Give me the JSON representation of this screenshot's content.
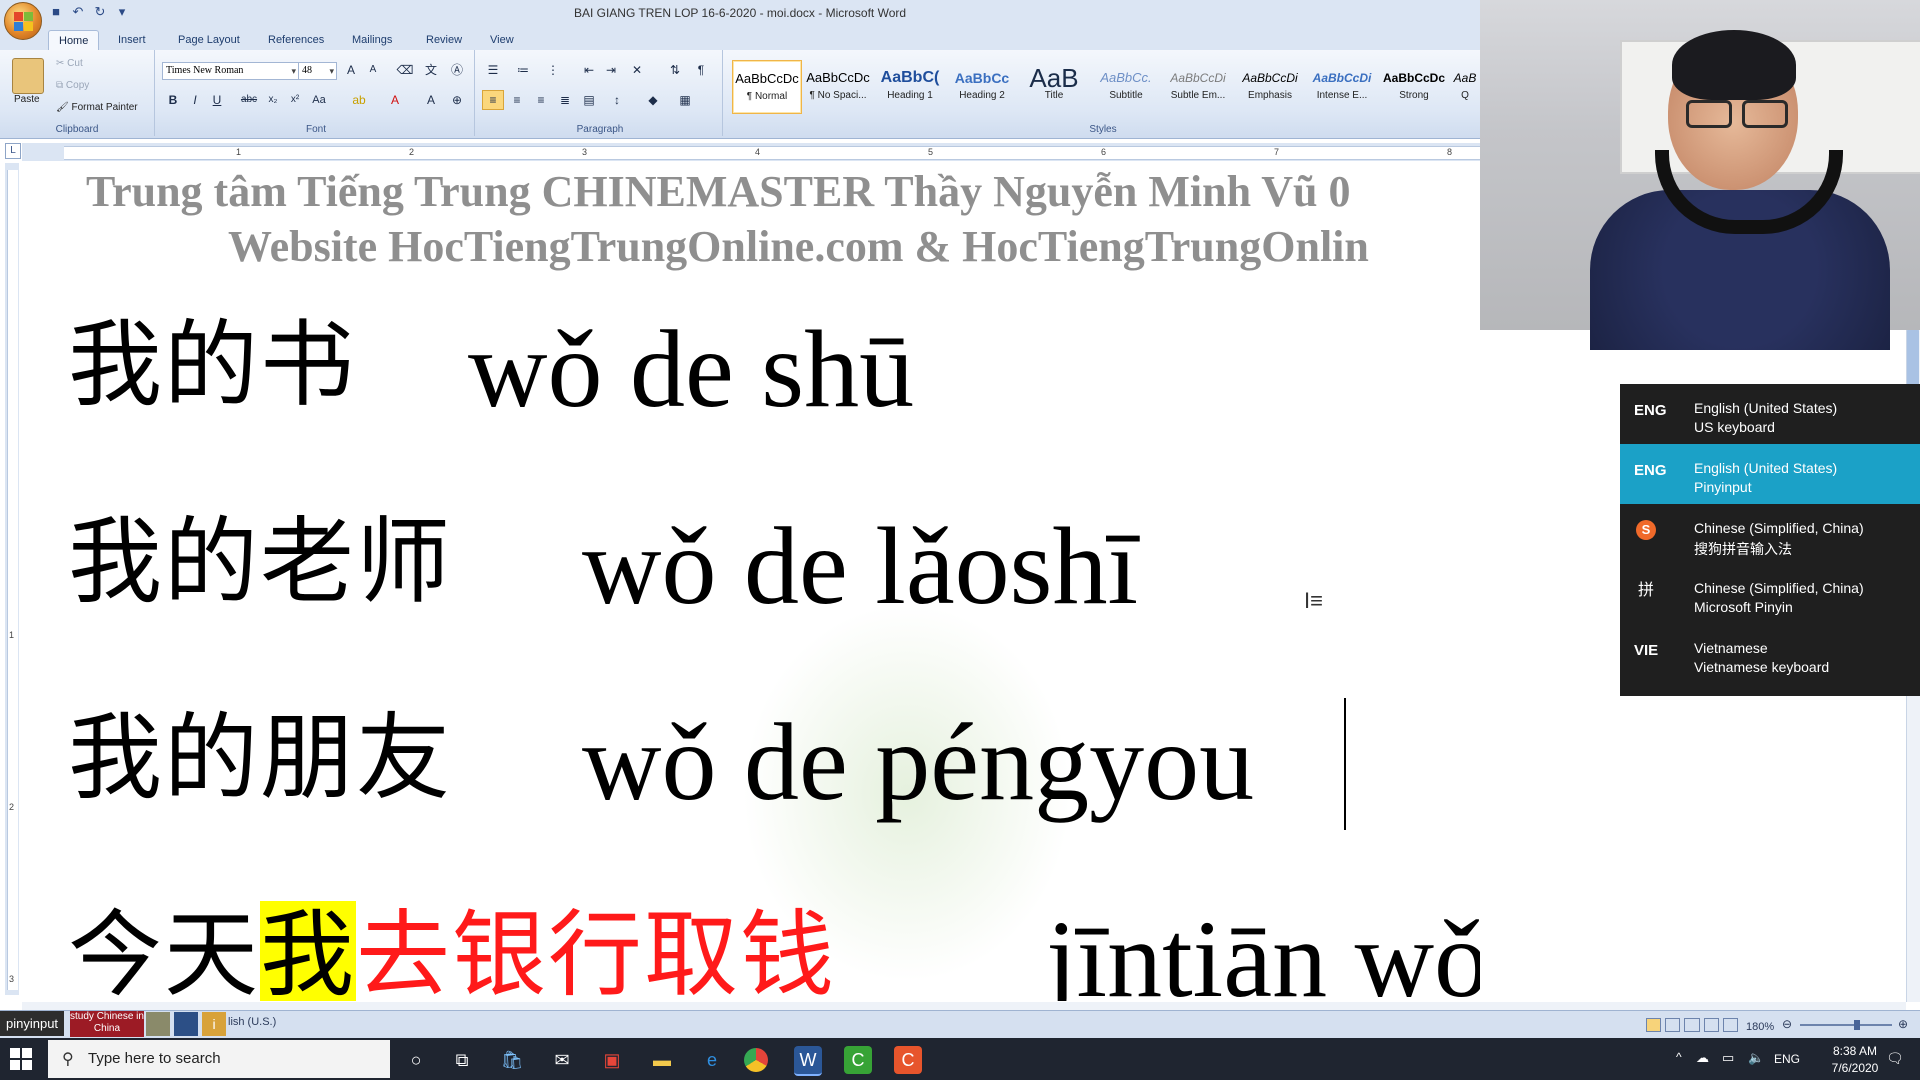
{
  "window": {
    "title": "BAI GIANG TREN LOP 16-6-2020 - moi.docx - Microsoft Word"
  },
  "tabs": [
    "Home",
    "Insert",
    "Page Layout",
    "References",
    "Mailings",
    "Review",
    "View"
  ],
  "ribbon": {
    "clipboard": {
      "paste": "Paste",
      "cut": "Cut",
      "copy": "Copy",
      "format_painter": "Format Painter",
      "label": "Clipboard"
    },
    "font": {
      "name": "Times New Roman",
      "size": "48",
      "label": "Font"
    },
    "paragraph": {
      "label": "Paragraph"
    },
    "styles": {
      "label": "Styles",
      "items": [
        {
          "preview": "AaBbCcDc",
          "name": "¶ Normal"
        },
        {
          "preview": "AaBbCcDc",
          "name": "¶ No Spaci..."
        },
        {
          "preview": "AaBbC(",
          "name": "Heading 1"
        },
        {
          "preview": "AaBbCc",
          "name": "Heading 2"
        },
        {
          "preview": "AaB",
          "name": "Title"
        },
        {
          "preview": "AaBbCc.",
          "name": "Subtitle"
        },
        {
          "preview": "AaBbCcDi",
          "name": "Subtle Em..."
        },
        {
          "preview": "AaBbCcDi",
          "name": "Emphasis"
        },
        {
          "preview": "AaBbCcDi",
          "name": "Intense E..."
        },
        {
          "preview": "AaBbCcDc",
          "name": "Strong"
        },
        {
          "preview": "AaB",
          "name": "Q"
        }
      ]
    }
  },
  "ruler": {
    "h_numbers": [
      "1",
      "2",
      "3",
      "4",
      "5",
      "6",
      "7",
      "8"
    ],
    "v_numbers": [
      "1",
      "2",
      "3"
    ]
  },
  "document": {
    "header_line1": "Trung tâm Tiếng Trung CHINEMASTER Thầy Nguyễn Minh Vũ 0",
    "header_line2": "Website HocTiengTrungOnline.com & HocTiengTrungOnlin",
    "lines": [
      {
        "hanzi": "我的书",
        "pinyin": "wǒ de shū"
      },
      {
        "hanzi": "我的老师",
        "pinyin": "wǒ de lǎoshī"
      },
      {
        "hanzi": "我的朋友",
        "pinyin": "wǒ de péngyou"
      }
    ],
    "line4": {
      "plain": "今天",
      "highlight": "我",
      "red": "去银行取钱",
      "pinyin": "jīntiān wǒ qù"
    }
  },
  "ime_menu": [
    {
      "code": "ENG",
      "line1": "English (United States)",
      "line2": "US keyboard",
      "selected": false
    },
    {
      "code": "ENG",
      "line1": "English (United States)",
      "line2": "Pinyinput",
      "selected": true
    },
    {
      "code": "S",
      "line1": "Chinese (Simplified, China)",
      "line2": "搜狗拼音输入法",
      "selected": false
    },
    {
      "code": "拼",
      "line1": "Chinese (Simplified, China)",
      "line2": "Microsoft Pinyin",
      "selected": false
    },
    {
      "code": "VIE",
      "line1": "Vietnamese",
      "line2": "Vietnamese keyboard",
      "selected": false
    }
  ],
  "statusbar": {
    "pinyinput": "pinyinput",
    "study": "study Chinese in China",
    "language": "lish (U.S.)",
    "zoom": "180%"
  },
  "taskbar": {
    "search_placeholder": "Type here to search",
    "tray_lang": "ENG",
    "time": "8:38 AM",
    "date": "7/6/2020"
  },
  "colors": {
    "accent": "#1ba1c7",
    "highlight": "#ffff00",
    "red_text": "#ff1a1a",
    "ribbon": "#dde7f5"
  }
}
